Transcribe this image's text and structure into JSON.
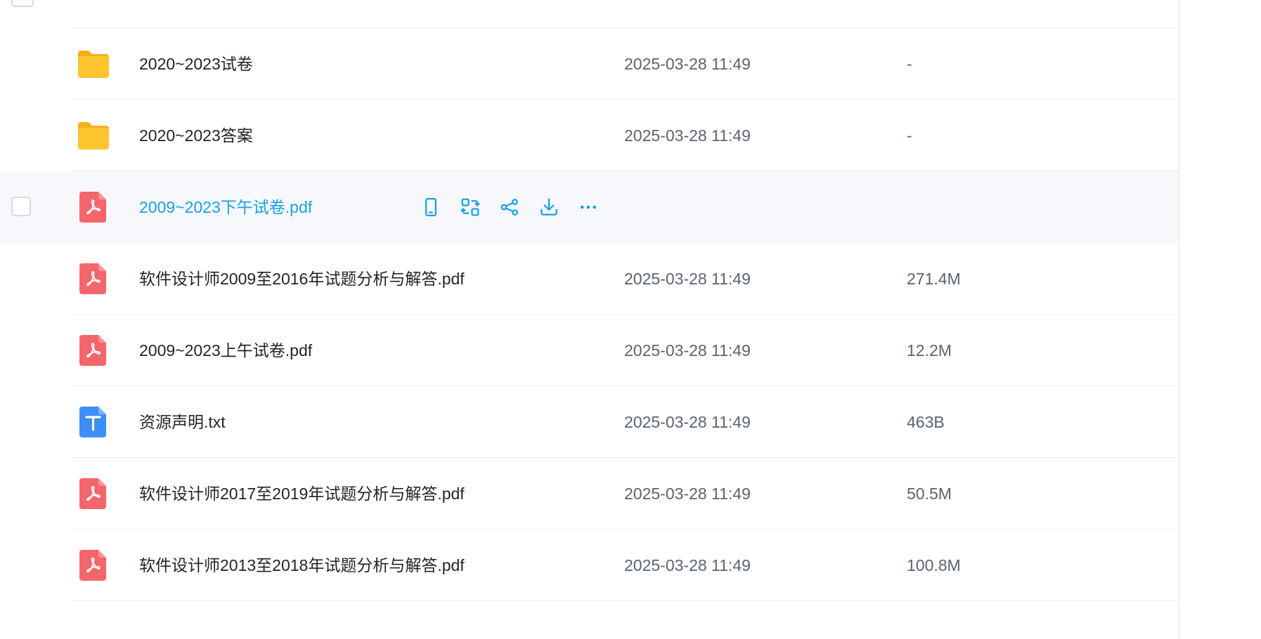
{
  "colors": {
    "accent": "#1aa0e6",
    "folder": "#ffc52e",
    "pdf": "#f4666b",
    "txt": "#3e8ef7",
    "hover_row": "#f6f8fb"
  },
  "files": [
    {
      "name": "2020~2023试卷",
      "type": "folder",
      "date": "2025-03-28 11:49",
      "size": "-"
    },
    {
      "name": "2020~2023答案",
      "type": "folder",
      "date": "2025-03-28 11:49",
      "size": "-"
    },
    {
      "name": "2009~2023下午试卷.pdf",
      "type": "pdf",
      "date": "",
      "size": "",
      "hover": true
    },
    {
      "name": "软件设计师2009至2016年试题分析与解答.pdf",
      "type": "pdf",
      "date": "2025-03-28 11:49",
      "size": "271.4M"
    },
    {
      "name": "2009~2023上午试卷.pdf",
      "type": "pdf",
      "date": "2025-03-28 11:49",
      "size": "12.2M"
    },
    {
      "name": "资源声明.txt",
      "type": "txt",
      "date": "2025-03-28 11:49",
      "size": "463B"
    },
    {
      "name": "软件设计师2017至2019年试题分析与解答.pdf",
      "type": "pdf",
      "date": "2025-03-28 11:49",
      "size": "50.5M"
    },
    {
      "name": "软件设计师2013至2018年试题分析与解答.pdf",
      "type": "pdf",
      "date": "2025-03-28 11:49",
      "size": "100.8M"
    }
  ],
  "hover_actions": [
    {
      "icon": "phone-icon"
    },
    {
      "icon": "convert-icon"
    },
    {
      "icon": "share-icon"
    },
    {
      "icon": "download-icon"
    },
    {
      "icon": "more-icon"
    }
  ]
}
